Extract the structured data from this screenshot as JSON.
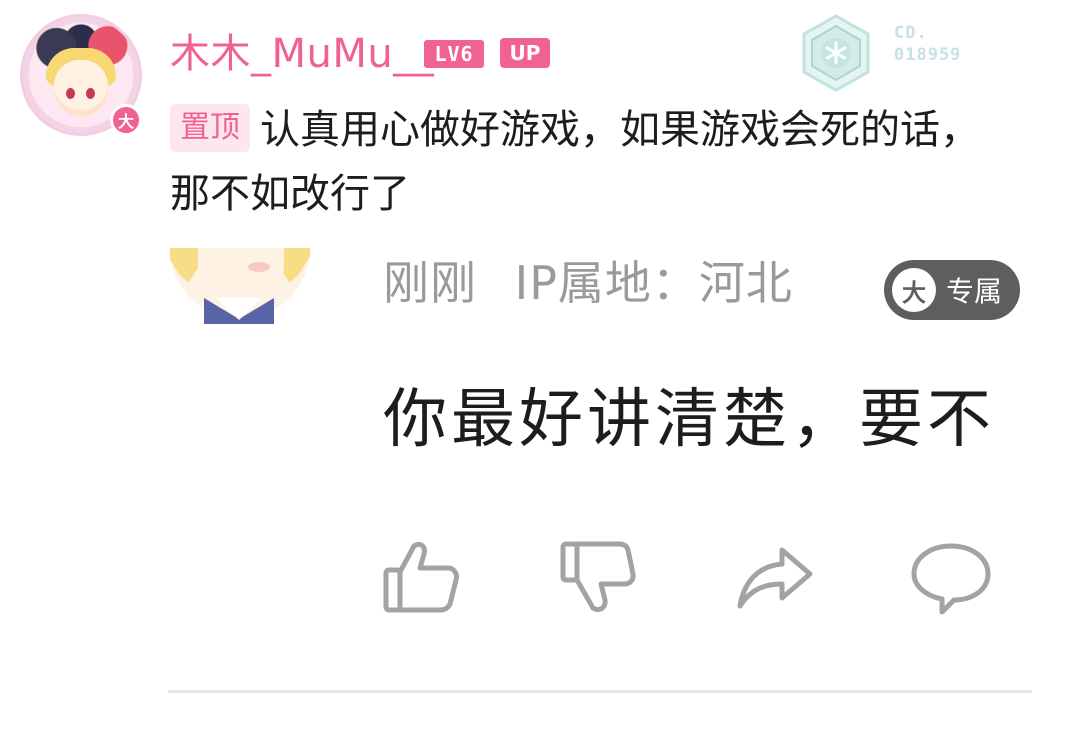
{
  "comment": {
    "username": "木木_MuMu__",
    "level": "LV6",
    "up_badge": "UP",
    "avatar_badge": "大",
    "medal_serial_line1": "CD.",
    "medal_serial_line2": "018959",
    "pin_tag": "置顶",
    "text": "认真用心做好游戏，如果游戏会死的话，那不如改行了"
  },
  "reply": {
    "timestamp": "刚刚",
    "ip_location": "IP属地：河北",
    "exclusive_icon": "大",
    "exclusive_label": "专属",
    "text": "你最好讲清楚，要不"
  },
  "actions": {
    "icons": [
      "thumbs-up-icon",
      "thumbs-down-icon",
      "share-icon",
      "comment-icon"
    ]
  },
  "colors": {
    "accent_pink": "#f0628f",
    "meta_gray": "#9a9a9a",
    "icon_gray": "#a3a3a3",
    "chip_dark": "#5e5e5e"
  }
}
